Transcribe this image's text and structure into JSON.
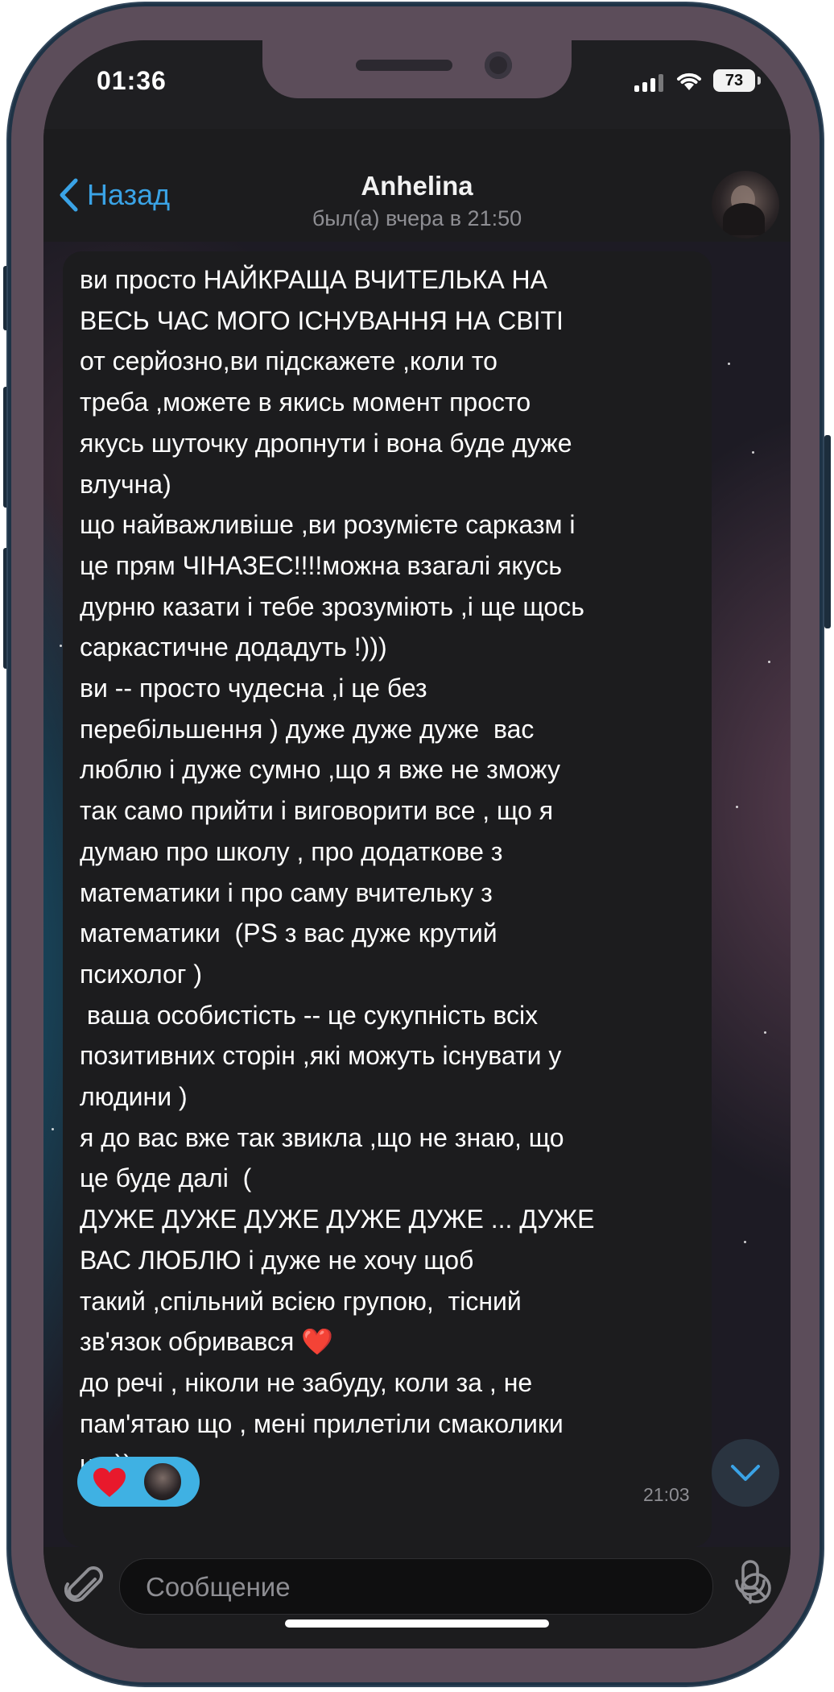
{
  "status_bar": {
    "time": "01:36",
    "battery": "73"
  },
  "header": {
    "back_label": "Назад",
    "contact_name": "Anhelina",
    "last_seen": "был(а) вчера в 21:50"
  },
  "message": {
    "text": "ви просто НАЙКРАЩА ВЧИТЕЛЬКА НА\nВЕСЬ ЧАС МОГО ІСНУВАННЯ НА СВІТІ\nот серйозно,ви підскажете ,коли то\nтреба ,можете в якись момент просто\nякусь шуточку дропнути і вона буде дуже\nвлучна)\nщо найважливіше ,ви розумієте сарказм і\nце прям ЧІНАЗЕС!!!!можна взагалі якусь\nдурню казати і тебе зрозуміють ,і ще щось\nсаркастичне додадуть !)))\nви -- просто чудесна ,і це без\nперебільшення ) дуже дуже дуже  вас\nлюблю і дуже сумно ,що я вже не зможу\nтак само прийти і виговорити все , що я\nдумаю про школу , про додаткове з\nматематики і про саму вчительку з\nматематики  (PS з вас дуже крутий\nпсихолог )\n ваша особистість -- це сукупність всіх\nпозитивних сторін ,які можуть існувати у\nлюдини )\nя до вас вже так звикла ,що не знаю, що\nце буде далі  (\nДУЖЕ ДУЖЕ ДУЖЕ ДУЖЕ ДУЖЕ ... ДУЖЕ\nВАС ЛЮБЛЮ і дуже не хочу щоб\nтакий ,спільний всією групою,  тісний\nзв'язок обривався ❤️\nдо речі , ніколи не забуду, коли за , не\nпам'ятаю що , мені прилетіли смаколики\nнп ))",
    "time": "21:03",
    "reaction": {
      "emoji_icon": "red-heart-icon",
      "color": "#3fb1e3"
    }
  },
  "input": {
    "placeholder": "Сообщение"
  },
  "colors": {
    "accent": "#3aa3e6",
    "bubble": "#1c1c1e"
  }
}
